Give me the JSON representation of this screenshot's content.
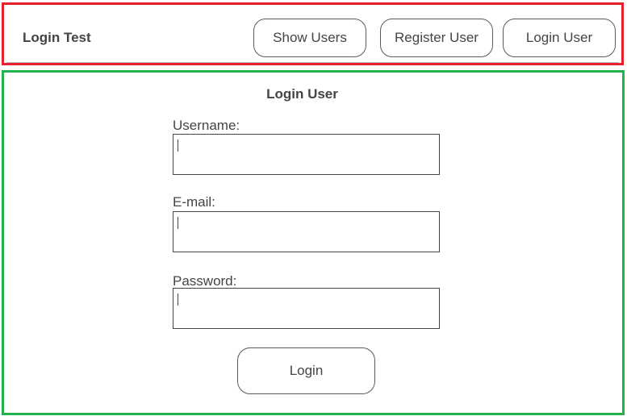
{
  "header": {
    "title": "Login Test",
    "nav": {
      "show_users": "Show Users",
      "register_user": "Register User",
      "login_user": "Login User"
    }
  },
  "form": {
    "title": "Login User",
    "username": {
      "label": "Username:",
      "value": ""
    },
    "email": {
      "label": "E-mail:",
      "value": ""
    },
    "password": {
      "label": "Password:",
      "value": ""
    },
    "submit_label": "Login"
  },
  "colors": {
    "header_outline": "#e8202b",
    "main_outline": "#22b24c"
  }
}
